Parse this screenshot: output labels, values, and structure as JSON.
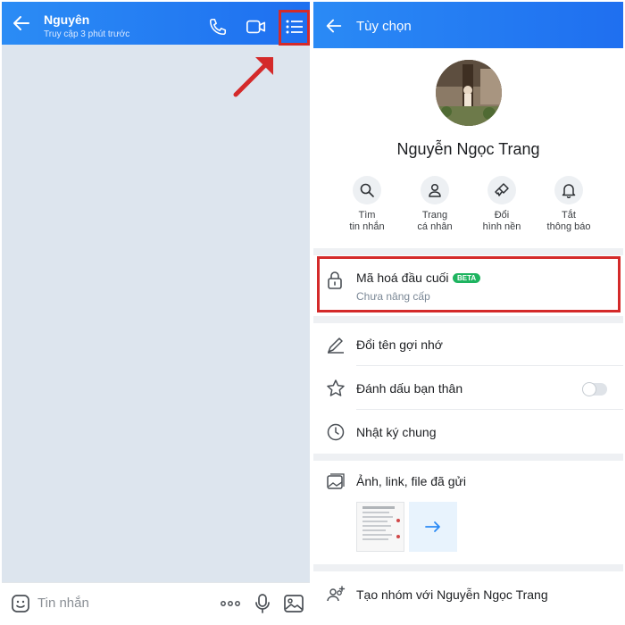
{
  "left_screen": {
    "header": {
      "contact_name": "Nguyên",
      "last_seen": "Truy cập 3 phút trước",
      "icons": [
        "back-arrow-icon",
        "phone-icon",
        "video-call-icon",
        "list-menu-icon"
      ]
    },
    "input_bar": {
      "placeholder": "Tin nhắn",
      "icons": [
        "sticker-icon",
        "more-dots-icon",
        "microphone-icon",
        "image-icon"
      ]
    },
    "annotation_color": "#d42a2a"
  },
  "right_screen": {
    "header": {
      "title": "Tùy chọn"
    },
    "profile": {
      "name": "Nguyễn Ngọc Trang"
    },
    "quick_actions": [
      {
        "line1": "Tìm",
        "line2": "tin nhắn",
        "icon": "search-icon"
      },
      {
        "line1": "Trang",
        "line2": "cá nhân",
        "icon": "person-icon"
      },
      {
        "line1": "Đổi",
        "line2": "hình nền",
        "icon": "paintbrush-icon"
      },
      {
        "line1": "Tắt",
        "line2": "thông báo",
        "icon": "bell-icon"
      }
    ],
    "encryption": {
      "title": "Mã hoá đầu cuối",
      "badge": "BETA",
      "status": "Chưa nâng cấp",
      "badge_color": "#1eb460"
    },
    "options": [
      {
        "label": "Đổi tên gợi nhớ",
        "icon": "pencil-icon"
      },
      {
        "label": "Đánh dấu bạn thân",
        "icon": "star-icon",
        "toggle_on": false
      },
      {
        "label": "Nhật ký chung",
        "icon": "clock-icon"
      }
    ],
    "media": {
      "label": "Ảnh, link, file đã gửi",
      "icon": "gallery-icon"
    },
    "create_group": {
      "label": "Tạo nhóm với Nguyễn Ngọc Trang",
      "icon": "group-add-icon"
    }
  },
  "colors": {
    "header_blue": "#1f6ff0",
    "chat_background": "#dde5ee",
    "annotation_red": "#d42a2a"
  }
}
